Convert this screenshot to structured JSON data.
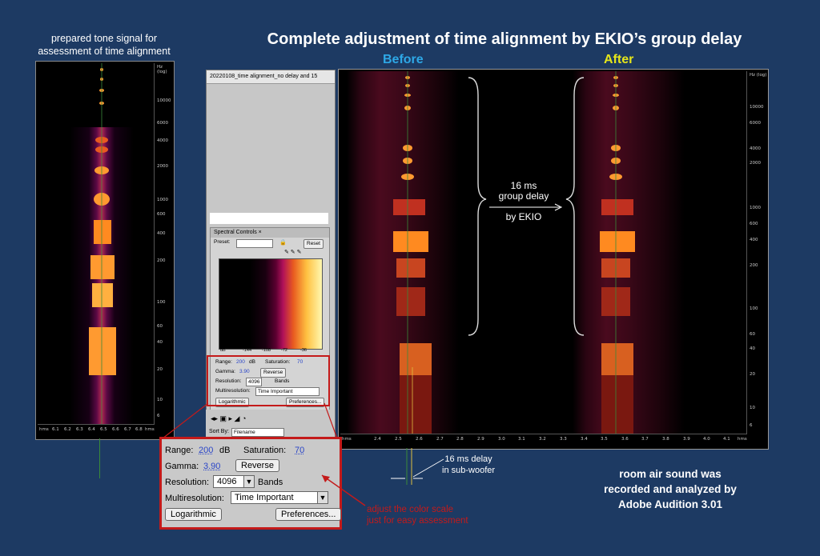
{
  "title": "Complete adjustment of time alignment by EKIO’s group delay",
  "before_label": "Before",
  "after_label": "After",
  "left_caption_line1": "prepared tone signal for",
  "left_caption_line2": "assessment of time alignment",
  "left_spec": {
    "freq_label": "Hz (log)",
    "freq_ticks": [
      "10000",
      "6000",
      "4000",
      "2000",
      "1000",
      "600",
      "400",
      "200",
      "100",
      "60",
      "40",
      "20",
      "10",
      "6"
    ],
    "time_ticks": [
      "hms",
      "6.1",
      "6.2",
      "6.3",
      "6.4",
      "6.5",
      "6.6",
      "6.7",
      "6.8",
      "hms"
    ]
  },
  "main_spec": {
    "freq_label": "Hz (log)",
    "freq_ticks": [
      "10000",
      "6000",
      "4000",
      "2000",
      "1000",
      "600",
      "400",
      "200",
      "100",
      "60",
      "40",
      "20",
      "10",
      "6"
    ],
    "time_ticks": [
      "hms",
      "2.4",
      "2.5",
      "2.6",
      "2.7",
      "2.8",
      "2.9",
      "3.0",
      "3.1",
      "3.2",
      "3.3",
      "3.4",
      "3.5",
      "3.6",
      "3.7",
      "3.8",
      "3.9",
      "4.0",
      "4.1",
      "hms"
    ]
  },
  "group_delay_line1": "16 ms",
  "group_delay_line2": "group delay",
  "group_delay_line3": "by EKIO",
  "delay_note_line1": "16 ms delay",
  "delay_note_line2": "in sub-woofer",
  "recorded_line1": "room air sound was",
  "recorded_line2": "recorded and analyzed by",
  "recorded_line3": "Adobe Audition 3.01",
  "adjust_line1": "adjust the color scale",
  "adjust_line2": "just for easy assessment",
  "audition": {
    "file_name": "20220108_time alignment_no delay and 15",
    "tab_label": "Spectral Controls",
    "preset_label": "Preset:",
    "reset_label": "Reset",
    "scale_ticks": [
      "dB",
      "-144",
      "-108",
      "-72",
      "-36"
    ],
    "sort_label": "Sort By:",
    "sort_value": "Filename"
  },
  "controls": {
    "range_label": "Range:",
    "range_value": "200",
    "range_unit": "dB",
    "saturation_label": "Saturation:",
    "saturation_value": "70",
    "gamma_label": "Gamma:",
    "gamma_value": "3.90",
    "reverse_label": "Reverse",
    "resolution_label": "Resolution:",
    "resolution_value": "4096",
    "bands_label": "Bands",
    "multires_label": "Multiresolution:",
    "multires_value": "Time Important",
    "logarithmic_label": "Logarithmic",
    "preferences_label": "Preferences..."
  }
}
